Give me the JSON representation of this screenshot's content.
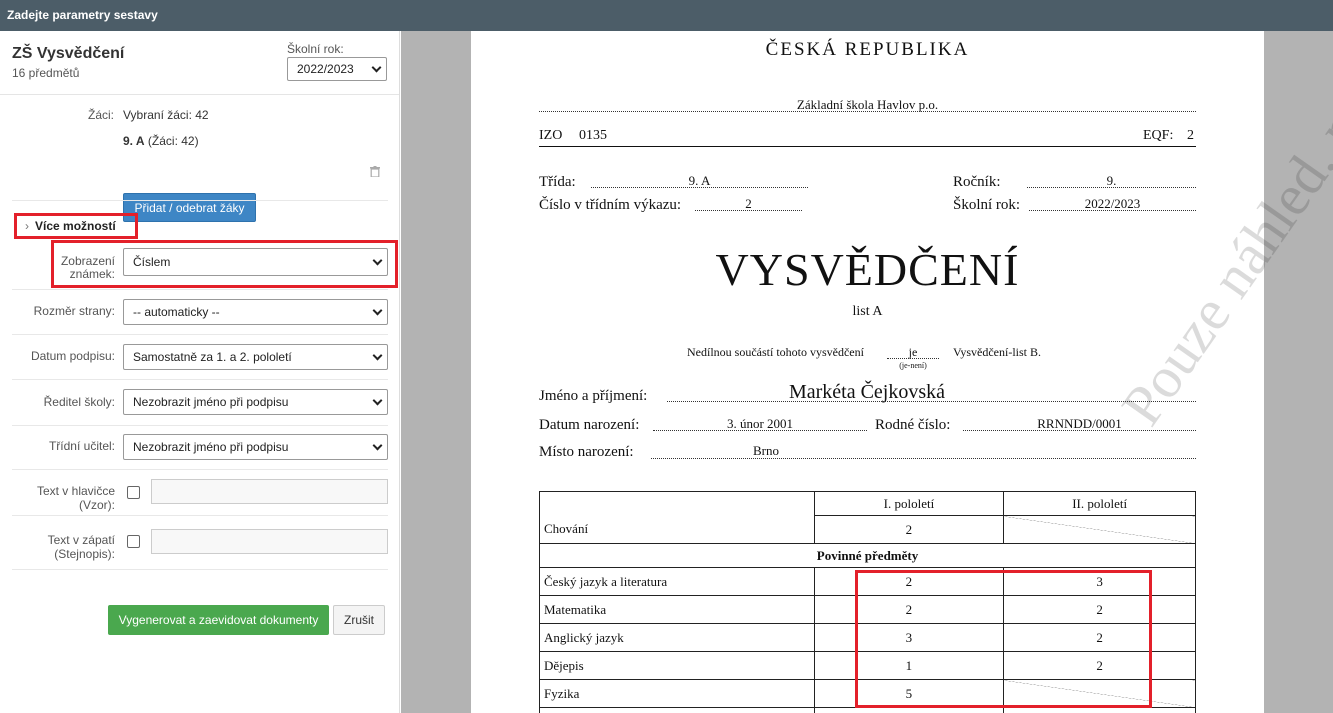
{
  "topbar": {
    "title": "Zadejte parametry sestavy"
  },
  "report": {
    "title": "ZŠ Vysvědčení",
    "subtitle": "16 předmětů"
  },
  "school_year": {
    "label": "Školní rok:",
    "value": "2022/2023"
  },
  "students": {
    "label": "Žáci:",
    "selected": "Vybraní žáci: 42",
    "class_name": "9. A",
    "class_count": "(Žáci: 42)",
    "add_button": "Přidat / odebrat žáky"
  },
  "more_options": {
    "label": "Více možností"
  },
  "fields": {
    "grade_display": {
      "label": "Zobrazení známek:",
      "value": "Číslem"
    },
    "page_size": {
      "label": "Rozměr strany:",
      "value": "-- automaticky --"
    },
    "sign_date": {
      "label": "Datum podpisu:",
      "value": "Samostatně za 1. a 2. pololetí"
    },
    "principal": {
      "label": "Ředitel školy:",
      "value": "Nezobrazit jméno při podpisu"
    },
    "teacher": {
      "label": "Třídní učitel:",
      "value": "Nezobrazit jméno při podpisu"
    },
    "header_text": {
      "label": "Text v hlavičce (Vzor):",
      "value": ""
    },
    "footer_text": {
      "label": "Text v zápatí (Stejnopis):",
      "value": ""
    }
  },
  "actions": {
    "generate": "Vygenerovat a zaevidovat dokumenty",
    "cancel": "Zrušit"
  },
  "certificate": {
    "country": "ČESKÁ REPUBLIKA",
    "school": "Základní škola Havlov p.o.",
    "izo_label": "IZO",
    "izo": "0135",
    "eqf_label": "EQF:",
    "eqf": "2",
    "class_label": "Třída:",
    "class": "9. A",
    "grade_label": "Ročník:",
    "grade": "9.",
    "list_no_label": "Číslo v třídním výkazu:",
    "list_no": "2",
    "year_label": "Školní rok:",
    "year": "2022/2023",
    "heading": "VYSVĚDČENÍ",
    "sheet": "list A",
    "integral_pre": "Nedílnou součástí tohoto vysvědčení",
    "integral_value": "je",
    "integral_hint": "(je-není)",
    "integral_post": "Vysvědčení-list B.",
    "name_label": "Jméno a příjmení:",
    "name": "Markéta Čejkovská",
    "birth_label": "Datum narození:",
    "birth": "3. únor 2001",
    "rc_label": "Rodné číslo:",
    "rc": "RRNNDD/0001",
    "place_label": "Místo narození:",
    "place": "Brno",
    "col1": "I. pololetí",
    "col2": "II. pololetí",
    "behaviour": {
      "name": "Chování",
      "h1": "2",
      "h2": ""
    },
    "section": "Povinné předměty",
    "subjects": [
      {
        "name": "Český jazyk a literatura",
        "h1": "2",
        "h2": "3"
      },
      {
        "name": "Matematika",
        "h1": "2",
        "h2": "2"
      },
      {
        "name": "Anglický jazyk",
        "h1": "3",
        "h2": "2"
      },
      {
        "name": "Dějepis",
        "h1": "1",
        "h2": "2"
      },
      {
        "name": "Fyzika",
        "h1": "5",
        "h2": ""
      }
    ],
    "watermark": "Pouze náhled, nevytisknout"
  }
}
